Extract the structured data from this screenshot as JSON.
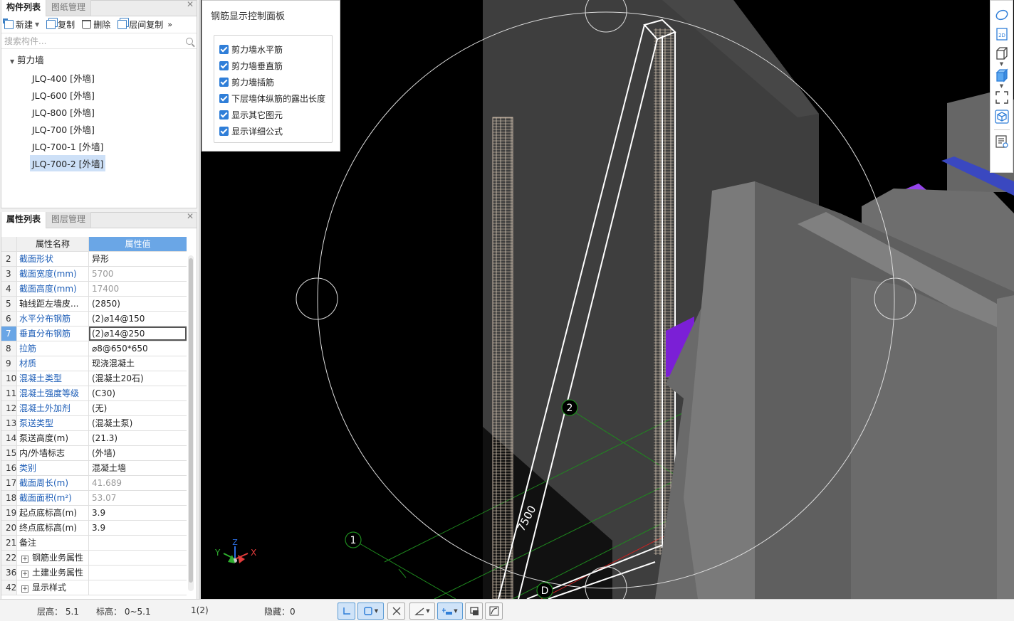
{
  "component_panel": {
    "tabs": [
      "构件列表",
      "图纸管理"
    ],
    "toolbar": {
      "new_label": "新建",
      "copy_label": "复制",
      "delete_label": "删除",
      "floor_copy_label": "层间复制",
      "more_label": "»"
    },
    "search_placeholder": "搜索构件...",
    "tree_root": "剪力墙",
    "items": [
      "JLQ-400 [外墙]",
      "JLQ-600 [外墙]",
      "JLQ-800 [外墙]",
      "JLQ-700 [外墙]",
      "JLQ-700-1 [外墙]",
      "JLQ-700-2 [外墙]"
    ],
    "selected_item": "JLQ-700-2 [外墙]"
  },
  "property_panel": {
    "tabs": [
      "属性列表",
      "图层管理"
    ],
    "header": {
      "name": "属性名称",
      "value": "属性值"
    },
    "rows": [
      {
        "num": "2",
        "name": "截面形状",
        "value": "异形",
        "name_blue": true,
        "value_gray": false
      },
      {
        "num": "3",
        "name": "截面宽度(mm)",
        "value": "5700",
        "name_blue": true,
        "value_gray": true
      },
      {
        "num": "4",
        "name": "截面高度(mm)",
        "value": "17400",
        "name_blue": true,
        "value_gray": true
      },
      {
        "num": "5",
        "name": "轴线距左墙皮...",
        "value": "(2850)",
        "name_blue": false,
        "value_gray": false
      },
      {
        "num": "6",
        "name": "水平分布钢筋",
        "value": "(2)⌀14@150",
        "name_blue": true,
        "value_gray": false
      },
      {
        "num": "7",
        "name": "垂直分布钢筋",
        "value": "(2)⌀14@250",
        "name_blue": true,
        "value_gray": false
      },
      {
        "num": "8",
        "name": "拉筋",
        "value": "⌀8@650*650",
        "name_blue": true,
        "value_gray": false
      },
      {
        "num": "9",
        "name": "材质",
        "value": "现浇混凝土",
        "name_blue": true,
        "value_gray": false
      },
      {
        "num": "10",
        "name": "混凝土类型",
        "value": "(混凝土20石)",
        "name_blue": true,
        "value_gray": false
      },
      {
        "num": "11",
        "name": "混凝土强度等级",
        "value": "(C30)",
        "name_blue": true,
        "value_gray": false
      },
      {
        "num": "12",
        "name": "混凝土外加剂",
        "value": "(无)",
        "name_blue": true,
        "value_gray": false
      },
      {
        "num": "13",
        "name": "泵送类型",
        "value": "(混凝土泵)",
        "name_blue": true,
        "value_gray": false
      },
      {
        "num": "14",
        "name": "泵送高度(m)",
        "value": "(21.3)",
        "name_blue": false,
        "value_gray": false
      },
      {
        "num": "15",
        "name": "内/外墙标志",
        "value": "(外墙)",
        "name_blue": false,
        "value_gray": false
      },
      {
        "num": "16",
        "name": "类别",
        "value": "混凝土墙",
        "name_blue": true,
        "value_gray": false
      },
      {
        "num": "17",
        "name": "截面周长(m)",
        "value": "41.689",
        "name_blue": true,
        "value_gray": true
      },
      {
        "num": "18",
        "name": "截面面积(m²)",
        "value": "53.07",
        "name_blue": true,
        "value_gray": true
      },
      {
        "num": "19",
        "name": "起点底标高(m)",
        "value": "3.9",
        "name_blue": false,
        "value_gray": false
      },
      {
        "num": "20",
        "name": "终点底标高(m)",
        "value": "3.9",
        "name_blue": false,
        "value_gray": false
      },
      {
        "num": "21",
        "name": "备注",
        "value": "",
        "name_blue": false,
        "value_gray": false
      }
    ],
    "groups": [
      {
        "num": "22",
        "name": "钢筋业务属性"
      },
      {
        "num": "36",
        "name": "土建业务属性"
      },
      {
        "num": "42",
        "name": "显示样式"
      }
    ],
    "selected_row": "7"
  },
  "rebar_panel": {
    "title": "钢筋显示控制面板",
    "options": [
      {
        "label": "剪力墙水平筋",
        "checked": true
      },
      {
        "label": "剪力墙垂直筋",
        "checked": true
      },
      {
        "label": "剪力墙插筋",
        "checked": true
      },
      {
        "label": "下层墙体纵筋的露出长度",
        "checked": true
      },
      {
        "label": "显示其它图元",
        "checked": true
      },
      {
        "label": "显示详细公式",
        "checked": true
      }
    ]
  },
  "viewport": {
    "axis_labels": [
      "1",
      "2",
      "D"
    ],
    "dimension_text": "7500",
    "gizmo": {
      "x": "X",
      "y": "Y",
      "z": "Z"
    },
    "colors": {
      "wall": "#5a5a5a",
      "wall_light": "#707070",
      "purple": "#7b1fd6",
      "grid": "#1e8a1e",
      "rebar": "#c9b8a8"
    }
  },
  "right_toolbar": {
    "icons": [
      "orbit-icon",
      "2d-view-icon",
      "3d-box-icon",
      "solid-box-icon",
      "fit-view-icon",
      "cube-view-icon",
      "property-view-icon"
    ],
    "label_2d": "2D"
  },
  "status_bar": {
    "floor_height": "层高： 5.1",
    "elevation": "标高： 0~5.1",
    "selection": "1(2)",
    "hidden": "隐藏：0"
  }
}
